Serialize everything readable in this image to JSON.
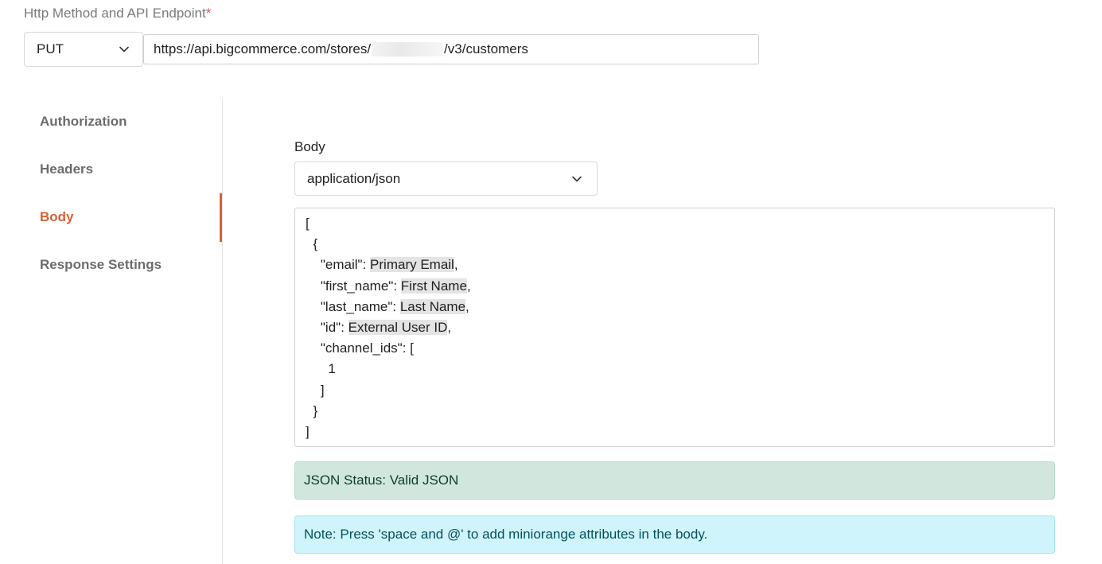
{
  "endpoint": {
    "label": "Http Method and API Endpoint",
    "required_mark": "*",
    "method": "PUT",
    "url_prefix": "https://api.bigcommerce.com/stores/",
    "url_suffix": "/v3/customers"
  },
  "side_nav": {
    "items": [
      {
        "label": "Authorization",
        "active": false
      },
      {
        "label": "Headers",
        "active": false
      },
      {
        "label": "Body",
        "active": true
      },
      {
        "label": "Response Settings",
        "active": false
      }
    ],
    "accent_color": "#d2643a"
  },
  "body": {
    "label": "Body",
    "content_type": "application/json",
    "editor": {
      "lines": [
        {
          "text": "[",
          "attr": "",
          "tail": ""
        },
        {
          "text": "  {",
          "attr": "",
          "tail": ""
        },
        {
          "text": "    \"email\": ",
          "attr": "Primary Email",
          "tail": ","
        },
        {
          "text": "    \"first_name\": ",
          "attr": "First Name",
          "tail": ","
        },
        {
          "text": "    \"last_name\": ",
          "attr": "Last Name",
          "tail": ","
        },
        {
          "text": "    \"id\": ",
          "attr": "External User ID",
          "tail": ","
        },
        {
          "text": "    \"channel_ids\": [",
          "attr": "",
          "tail": ""
        },
        {
          "text": "      1",
          "attr": "",
          "tail": ""
        },
        {
          "text": "    ]",
          "attr": "",
          "tail": ""
        },
        {
          "text": "  }",
          "attr": "",
          "tail": ""
        },
        {
          "text": "]",
          "attr": "",
          "tail": ""
        }
      ]
    },
    "status_text": "JSON Status: Valid JSON",
    "note_text": "Note: Press 'space and @' to add miniorange attributes in the body."
  },
  "icons": {
    "method_chevron": "chevron-down-icon",
    "content_type_chevron": "chevron-down-icon"
  },
  "colors": {
    "status_bg": "#d1e7dd",
    "note_bg": "#cff4fc",
    "required": "#d9534f"
  }
}
